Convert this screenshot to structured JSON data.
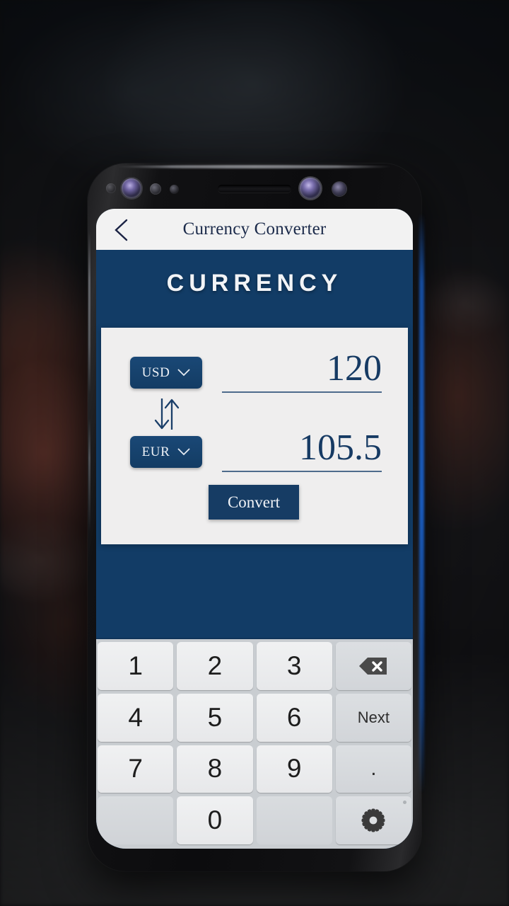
{
  "background": {
    "description": "blurred dark city street at night",
    "accent_color": "#123c66"
  },
  "device": {
    "name": "smartphone-mockup",
    "sensors": [
      "ir-sensor",
      "front-camera-left",
      "proximity-sensor",
      "light-sensor",
      "earpiece-speaker",
      "front-camera-right",
      "secondary-sensor"
    ]
  },
  "app_bar": {
    "back_icon": "chevron-left-icon",
    "title": "Currency Converter"
  },
  "screen": {
    "heading": "CURRENCY",
    "background_color": "#123c66",
    "card_background": "#efeeee"
  },
  "converter": {
    "from": {
      "currency_code": "USD",
      "dropdown_icon": "chevron-down-icon",
      "amount": "120"
    },
    "to": {
      "currency_code": "EUR",
      "dropdown_icon": "chevron-down-icon",
      "amount": "105.5"
    },
    "swap_icon": "swap-vertical-arrows-icon",
    "convert_label": "Convert"
  },
  "keyboard": {
    "rows": [
      [
        {
          "label": "1",
          "type": "digit",
          "icon": null
        },
        {
          "label": "2",
          "type": "digit",
          "icon": null
        },
        {
          "label": "3",
          "type": "digit",
          "icon": null
        },
        {
          "label": "",
          "type": "fn",
          "icon": "backspace-icon"
        }
      ],
      [
        {
          "label": "4",
          "type": "digit",
          "icon": null
        },
        {
          "label": "5",
          "type": "digit",
          "icon": null
        },
        {
          "label": "6",
          "type": "digit",
          "icon": null
        },
        {
          "label": "Next",
          "type": "fn",
          "icon": null
        }
      ],
      [
        {
          "label": "7",
          "type": "digit",
          "icon": null
        },
        {
          "label": "8",
          "type": "digit",
          "icon": null
        },
        {
          "label": "9",
          "type": "digit",
          "icon": null
        },
        {
          "label": ".",
          "type": "dot",
          "icon": null
        }
      ],
      [
        {
          "label": "",
          "type": "blank",
          "icon": null
        },
        {
          "label": "0",
          "type": "digit",
          "icon": null
        },
        {
          "label": "",
          "type": "blank",
          "icon": null
        },
        {
          "label": "",
          "type": "fn",
          "icon": "settings-gear-icon"
        }
      ]
    ]
  }
}
